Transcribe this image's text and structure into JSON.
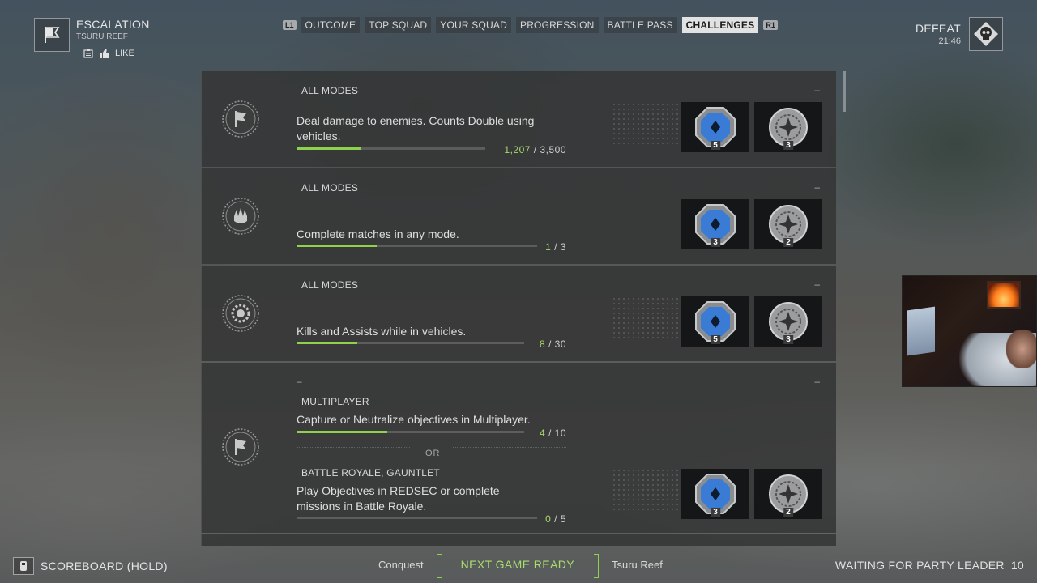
{
  "header": {
    "mode_title": "ESCALATION",
    "map_name": "TSURU REEF",
    "like_label": "LIKE",
    "result_label": "DEFEAT",
    "result_time": "21:46"
  },
  "tabs": {
    "left_hint": "L1",
    "right_hint": "R1",
    "items": [
      {
        "label": "OUTCOME",
        "active": false
      },
      {
        "label": "TOP SQUAD",
        "active": false
      },
      {
        "label": "YOUR SQUAD",
        "active": false
      },
      {
        "label": "PROGRESSION",
        "active": false
      },
      {
        "label": "BATTLE PASS",
        "active": false
      },
      {
        "label": "CHALLENGES",
        "active": true
      }
    ]
  },
  "challenges": [
    {
      "mode": "ALL MODES",
      "description": "Deal damage to enemies. Counts Double using vehicles.",
      "current": "1,207",
      "target": "3,500",
      "progress": 0.345,
      "dash": "–",
      "rewards": [
        {
          "icon": "blue-token-icon",
          "count": "5"
        },
        {
          "icon": "silver-token-icon",
          "count": "3"
        }
      ]
    },
    {
      "mode": "ALL MODES",
      "description": "Complete matches in any mode.",
      "current": "1",
      "target": "3",
      "progress": 0.333,
      "dash": "–",
      "rewards": [
        {
          "icon": "blue-token-icon",
          "count": "3"
        },
        {
          "icon": "silver-token-icon",
          "count": "2"
        }
      ]
    },
    {
      "mode": "ALL MODES",
      "description": "Kills and Assists while in vehicles.",
      "current": "8",
      "target": "30",
      "progress": 0.267,
      "dash": "–",
      "rewards": [
        {
          "icon": "blue-token-icon",
          "count": "5"
        },
        {
          "icon": "silver-token-icon",
          "count": "3"
        }
      ]
    },
    {
      "dash_top": "–",
      "dash": "–",
      "or_label": "OR",
      "parts": [
        {
          "mode": "MULTIPLAYER",
          "description": "Capture or Neutralize objectives in Multiplayer.",
          "current": "4",
          "target": "10",
          "progress": 0.4
        },
        {
          "mode": "BATTLE ROYALE, GAUNTLET",
          "description": "Play Objectives in REDSEC or complete missions in Battle Royale.",
          "current": "0",
          "target": "5",
          "progress": 0.0
        }
      ],
      "rewards": [
        {
          "icon": "blue-token-icon",
          "count": "3"
        },
        {
          "icon": "silver-token-icon",
          "count": "2"
        }
      ]
    }
  ],
  "footer": {
    "scoreboard_label": "SCOREBOARD (HOLD)",
    "next_mode": "Conquest",
    "next_status": "NEXT GAME READY",
    "next_map": "Tsuru Reef",
    "waiting_label": "WAITING FOR PARTY LEADER",
    "waiting_count": "10"
  },
  "colors": {
    "accent_green": "#8ed14a",
    "panel_bg": "#343636",
    "token_blue": "#3a7bd5"
  }
}
